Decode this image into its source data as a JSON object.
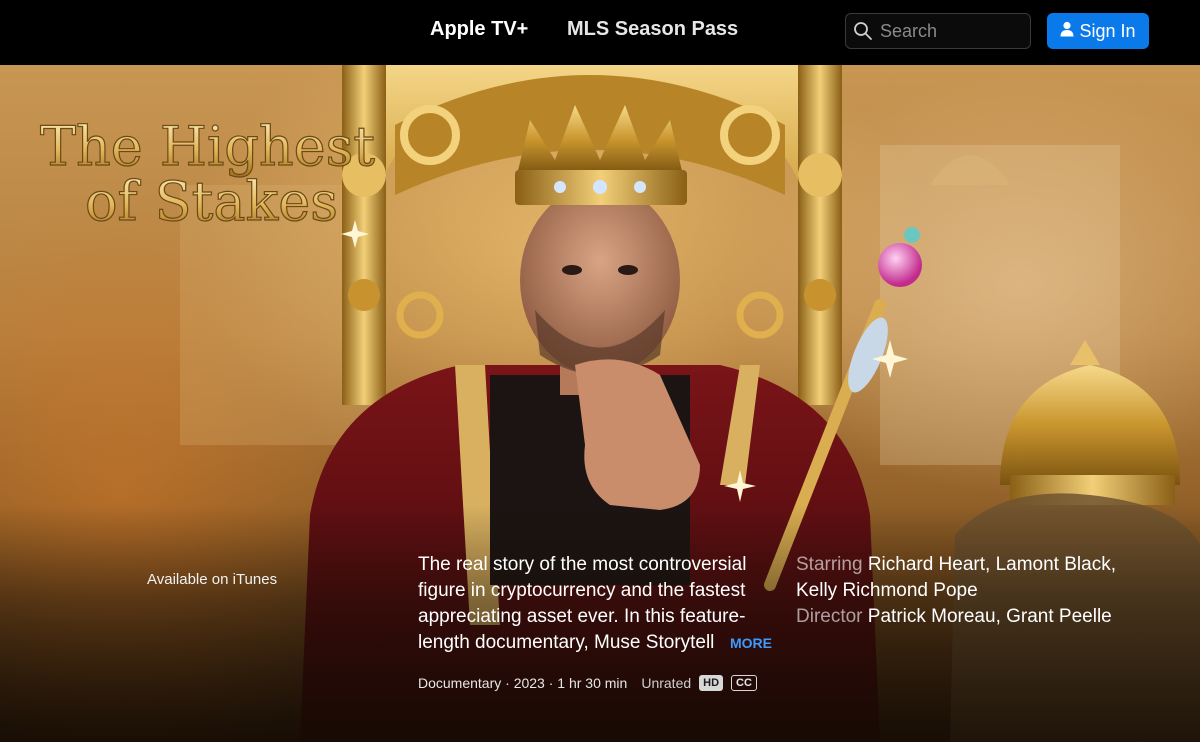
{
  "nav": {
    "apple_tv_label": "Apple TV+",
    "mls_label": "MLS Season Pass",
    "search_placeholder": "Search",
    "sign_in_label": "Sign In"
  },
  "hero": {
    "title_line1": "The Highest",
    "title_line2": "of Stakes",
    "availability": "Available on iTunes",
    "synopsis_lines": [
      "The real story of the most controversial",
      "figure in cryptocurrency and the fastest",
      "appreciating asset ever. In this feature-",
      "length documentary, Muse Storytell"
    ],
    "more_label": "MORE",
    "starring_label": "Starring",
    "starring_line1": "Richard Heart, Lamont Black,",
    "starring_line2": "Kelly Richmond Pope",
    "director_label": "Director",
    "director_value": "Patrick Moreau, Grant Peelle",
    "meta_text": "Documentary · 2023 · 1 hr 30 min",
    "rating": "Unrated",
    "badge_hd": "HD",
    "badge_cc": "CC"
  },
  "colors": {
    "nav_bg": "#000000",
    "accent_blue": "#0a7aeb",
    "more_link": "#3d9bff",
    "title_gold": "#e8c46a"
  },
  "icons": [
    "search-icon",
    "person-icon"
  ]
}
